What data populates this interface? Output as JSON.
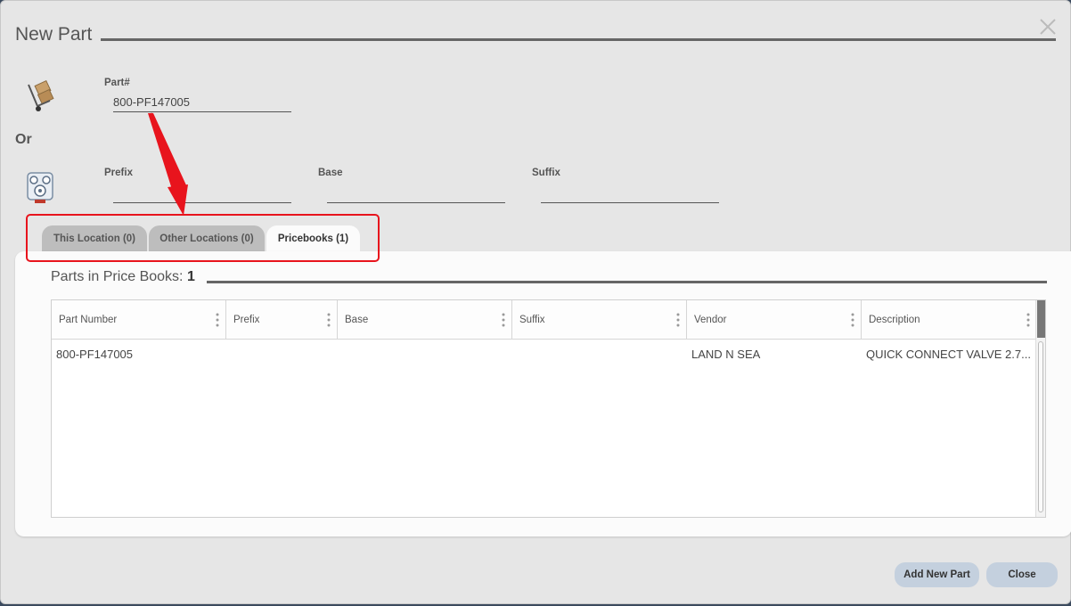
{
  "dialog": {
    "title": "New Part",
    "close_icon": "close-icon"
  },
  "part_number": {
    "label": "Part#",
    "value": "800-PF147005",
    "icon": "hand-truck-icon"
  },
  "or_label": "Or",
  "split_fields": {
    "icon": "parts-gear-icon",
    "prefix_label": "Prefix",
    "prefix_value": "",
    "base_label": "Base",
    "base_value": "",
    "suffix_label": "Suffix",
    "suffix_value": ""
  },
  "tabs": [
    {
      "label": "This Location (0)",
      "active": false
    },
    {
      "label": "Other Locations (0)",
      "active": false
    },
    {
      "label": "Pricebooks (1)",
      "active": true
    }
  ],
  "panel": {
    "title_prefix": "Parts in Price Books: ",
    "count": "1"
  },
  "grid": {
    "columns": [
      "Part Number",
      "Prefix",
      "Base",
      "Suffix",
      "Vendor",
      "Description"
    ],
    "rows": [
      [
        "800-PF147005",
        "",
        "",
        "",
        "LAND N SEA",
        "QUICK CONNECT VALVE 2.7..."
      ]
    ]
  },
  "buttons": {
    "add_new_part": "Add New Part",
    "close": "Close"
  },
  "annotation": {
    "highlight_color": "#e8141d"
  }
}
